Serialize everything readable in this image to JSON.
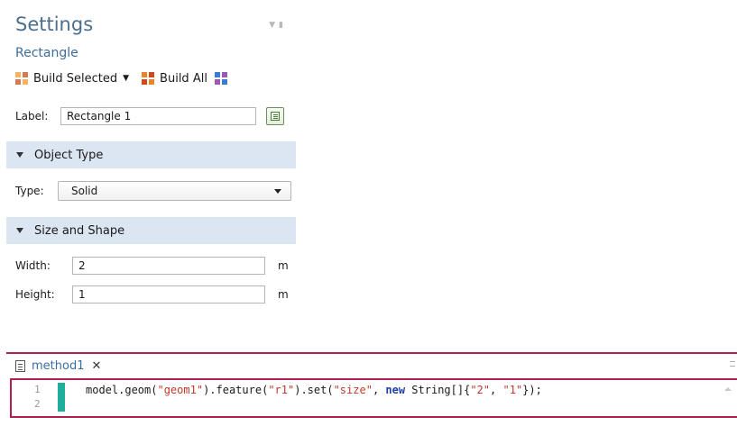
{
  "settings": {
    "title": "Settings",
    "subtitle": "Rectangle",
    "toolbar": {
      "build_selected": "Build Selected",
      "build_all": "Build All"
    },
    "label": {
      "caption": "Label:",
      "value": "Rectangle 1"
    },
    "object_type": {
      "header": "Object Type",
      "type_caption": "Type:",
      "type_value": "Solid"
    },
    "size_shape": {
      "header": "Size and Shape",
      "width_caption": "Width:",
      "width_value": "2",
      "width_unit": "m",
      "height_caption": "Height:",
      "height_value": "1",
      "height_unit": "m"
    }
  },
  "editor": {
    "tab_label": "method1",
    "tab_close": "✕",
    "lines": [
      "1",
      "2"
    ],
    "code": {
      "p1": "model.geom(",
      "s1": "\"geom1\"",
      "p2": ").feature(",
      "s2": "\"r1\"",
      "p3": ").set(",
      "s3": "\"size\"",
      "p4": ", ",
      "kw": "new",
      "p5": " String[]{",
      "s4": "\"2\"",
      "p6": ", ",
      "s5": "\"1\"",
      "p7": "});"
    }
  },
  "colors": {
    "section_header_bg": "#dce6f2",
    "title_blue": "#4a6f8e",
    "editor_accent": "#b31d52",
    "change_bar": "#1fae9c",
    "string_literal": "#c0392b",
    "keyword": "#1f3fa8"
  },
  "icons": {
    "build_selected": "build-selected-icon",
    "build_all": "build-all-icon",
    "graphics": "graphics-icon",
    "label_edit": "label-edit-icon",
    "method_doc": "document-icon"
  }
}
